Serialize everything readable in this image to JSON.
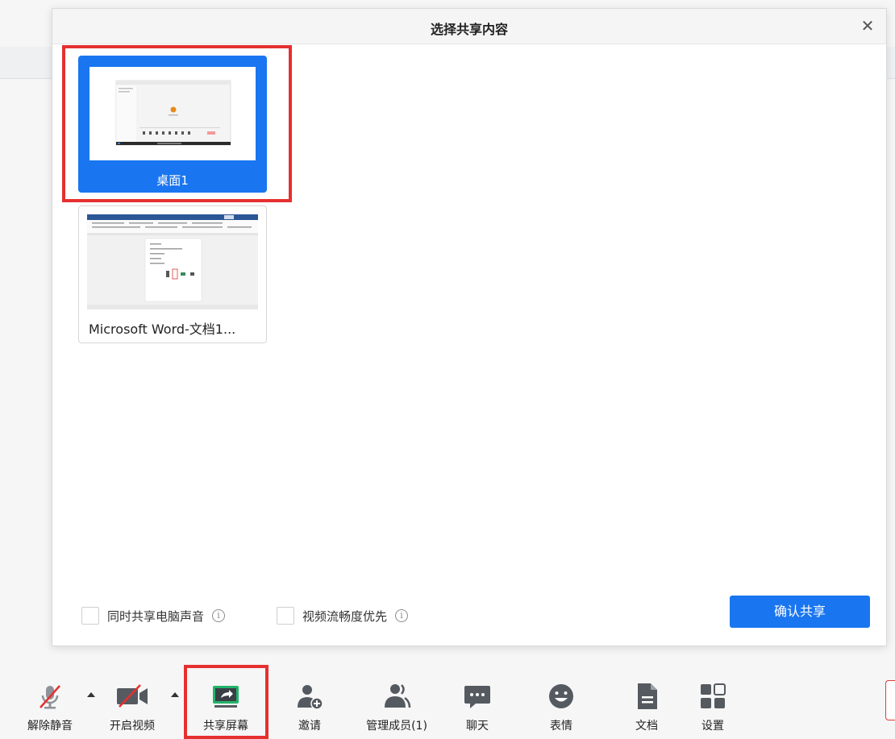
{
  "dialog": {
    "title": "选择共享内容",
    "close_icon": "close-icon"
  },
  "share_items": [
    {
      "label": "桌面1",
      "selected": true
    },
    {
      "label": "Microsoft Word-文档1...",
      "selected": false
    }
  ],
  "options": {
    "share_audio": {
      "label": "同时共享电脑声音",
      "checked": false,
      "info": "ⓘ"
    },
    "video_smooth": {
      "label": "视频流畅度优先",
      "checked": false,
      "info": "ⓘ"
    }
  },
  "confirm_button": "确认共享",
  "toolbar": {
    "items": [
      {
        "label": "解除静音",
        "icon": "muted-microphone-icon"
      },
      {
        "label": "开启视频",
        "icon": "video-off-icon"
      },
      {
        "label": "共享屏幕",
        "icon": "share-screen-icon"
      },
      {
        "label": "邀请",
        "icon": "invite-user-icon"
      },
      {
        "label": "管理成员(1)",
        "icon": "members-icon"
      },
      {
        "label": "聊天",
        "icon": "chat-icon"
      },
      {
        "label": "表情",
        "icon": "emoji-icon"
      },
      {
        "label": "文档",
        "icon": "document-icon"
      },
      {
        "label": "设置",
        "icon": "settings-grid-icon"
      }
    ]
  },
  "colors": {
    "accent": "#1a76f0",
    "highlight": "#e53030",
    "icon_gray": "#555a61",
    "share_green": "#22b36a"
  }
}
